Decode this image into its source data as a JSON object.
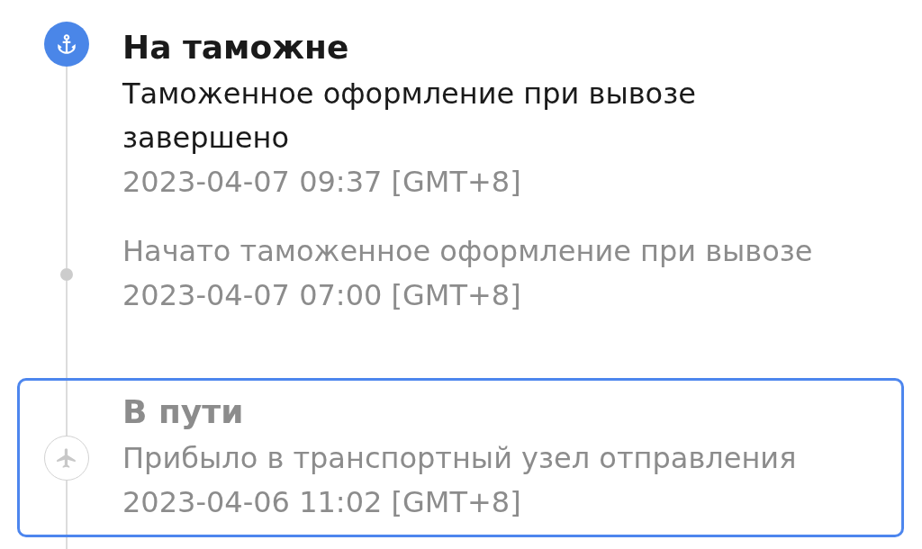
{
  "timeline": [
    {
      "kind": "customs",
      "active": true,
      "selected": false,
      "title": "На таможне",
      "description": "Таможенное оформление при вывозе завершено",
      "time": "2023-04-07 09:37 [GMT+8]"
    },
    {
      "kind": "update",
      "active": false,
      "selected": false,
      "description": "Начато таможенное оформление при вывозе",
      "time": "2023-04-07 07:00 [GMT+8]"
    },
    {
      "kind": "transit",
      "active": false,
      "selected": true,
      "title": "В пути",
      "description": "Прибыло в транспортный узел отправления",
      "time": "2023-04-06 11:02 [GMT+8]"
    }
  ]
}
